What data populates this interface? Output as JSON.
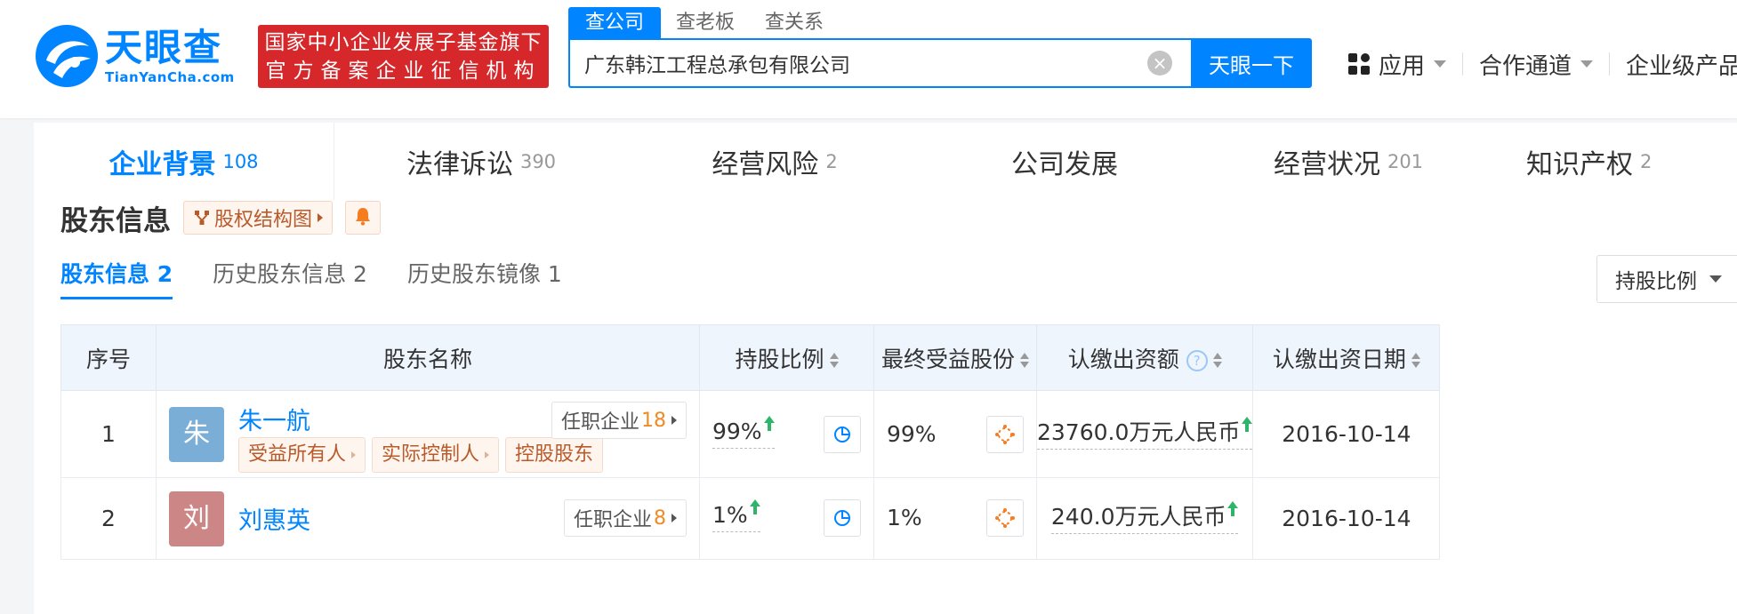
{
  "header": {
    "logo_cn": "天眼查",
    "logo_en": "TianYanCha.com",
    "gov_badge_line1": "国家中小企业发展子基金旗下",
    "gov_badge_line2": "官方备案企业征信机构",
    "search_tabs": [
      "查公司",
      "查老板",
      "查关系"
    ],
    "search_value": "广东韩江工程总承包有限公司",
    "search_button": "天眼一下",
    "nav": {
      "apps": "应用",
      "partner": "合作通道",
      "enterprise": "企业级产品"
    },
    "brand_color": "#0084ff",
    "badge_color": "#d6272b"
  },
  "category_tabs": [
    {
      "label": "企业背景",
      "count": "108"
    },
    {
      "label": "法律诉讼",
      "count": "390"
    },
    {
      "label": "经营风险",
      "count": "2"
    },
    {
      "label": "公司发展",
      "count": ""
    },
    {
      "label": "经营状况",
      "count": "201"
    },
    {
      "label": "知识产权",
      "count": "2"
    }
  ],
  "section": {
    "title": "股东信息",
    "equity_button": "股权结构图",
    "sub_tabs": [
      "股东信息 2",
      "历史股东信息 2",
      "历史股东镜像 1"
    ],
    "sort_select": "持股比例"
  },
  "table": {
    "headers": {
      "seq": "序号",
      "name": "股东名称",
      "ratio": "持股比例",
      "final": "最终受益股份",
      "capital": "认缴出资额",
      "date": "认缴出资日期"
    },
    "rows": [
      {
        "seq": "1",
        "avatar": "朱",
        "avatar_color": "#7aaed6",
        "name": "朱一航",
        "tags": [
          "受益所有人",
          "实际控制人",
          "控股股东"
        ],
        "post_label": "任职企业",
        "post_count": "18",
        "ratio": "99%",
        "final": "99%",
        "capital": "23760.0万元人民币",
        "date": "2016-10-14"
      },
      {
        "seq": "2",
        "avatar": "刘",
        "avatar_color": "#cd8686",
        "name": "刘惠英",
        "tags": [],
        "post_label": "任职企业",
        "post_count": "8",
        "ratio": "1%",
        "final": "1%",
        "capital": "240.0万元人民币",
        "date": "2016-10-14"
      }
    ]
  }
}
